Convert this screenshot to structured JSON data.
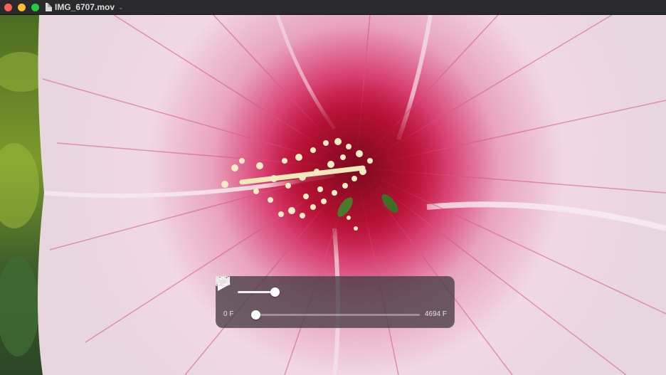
{
  "window": {
    "title": "IMG_6707.mov",
    "title_menu_icon": "chevron-down-icon",
    "document_icon": "movie-file-icon"
  },
  "controls": {
    "volume_icon": "speaker-icon",
    "volume_level": 0.92,
    "rewind_icon": "rewind-icon",
    "play_icon": "play-icon",
    "fast_forward_icon": "fast-forward-icon",
    "airplay_icon": "airplay-icon",
    "pip_icon": "picture-in-picture-icon",
    "more_icon": "double-chevron-right-icon",
    "current_time": "0 F",
    "total_time": "4694 F",
    "playback_position": 0.0
  },
  "colors": {
    "titlebar": "#2a2a2c",
    "hud_background": "#463c42",
    "close": "#fe5f57",
    "minimize": "#febc2e",
    "zoom": "#28c840"
  }
}
